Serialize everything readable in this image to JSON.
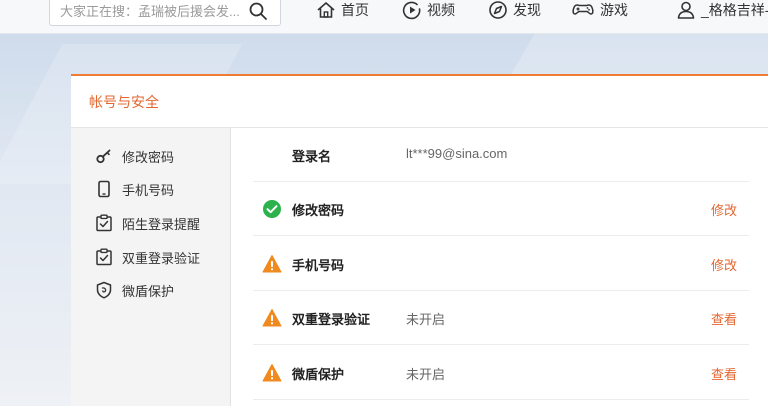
{
  "topbar": {
    "search_placeholder": "大家正在搜：孟瑞被后援会发...",
    "nav": [
      {
        "label": "首页",
        "icon": "home-icon"
      },
      {
        "label": "视频",
        "icon": "video-icon"
      },
      {
        "label": "发现",
        "icon": "compass-icon"
      },
      {
        "label": "游戏",
        "icon": "gamepad-icon"
      },
      {
        "label": "_格格吉祥--矢",
        "icon": "user-icon"
      }
    ]
  },
  "panel": {
    "title": "帐号与安全",
    "accent_color": "#e3662f",
    "sidebar": [
      {
        "label": "修改密码",
        "icon": "key-icon"
      },
      {
        "label": "手机号码",
        "icon": "phone-icon"
      },
      {
        "label": "陌生登录提醒",
        "icon": "login-alert-icon"
      },
      {
        "label": "双重登录验证",
        "icon": "double-verify-icon"
      },
      {
        "label": "微盾保护",
        "icon": "shield-icon"
      }
    ],
    "rows": [
      {
        "label": "登录名",
        "value": "lt***99@sina.com",
        "status": "",
        "action": ""
      },
      {
        "label": "修改密码",
        "value": "",
        "status": "ok",
        "action": "修改"
      },
      {
        "label": "手机号码",
        "value": "",
        "status": "warning",
        "action": "修改"
      },
      {
        "label": "双重登录验证",
        "value": "未开启",
        "status": "warning",
        "action": "查看"
      },
      {
        "label": "微盾保护",
        "value": "未开启",
        "status": "warning",
        "action": "查看"
      }
    ],
    "status_colors": {
      "ok": "#2bb24c",
      "warning": "#f08a1f"
    }
  }
}
